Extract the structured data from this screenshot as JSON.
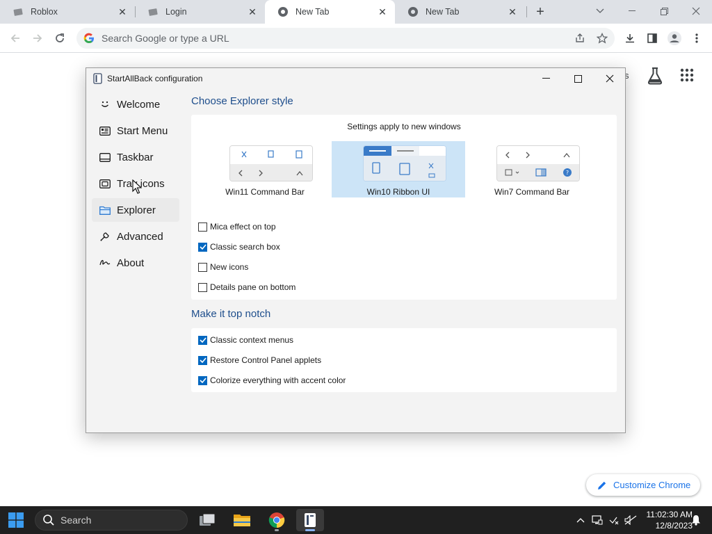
{
  "browser": {
    "tabs": [
      {
        "title": "Roblox",
        "active": false
      },
      {
        "title": "Login",
        "active": false
      },
      {
        "title": "New Tab",
        "active": true
      },
      {
        "title": "New Tab",
        "active": false
      }
    ],
    "omnibox_placeholder": "Search Google or type a URL",
    "ntp_partial_text": "s",
    "customize_label": "Customize Chrome"
  },
  "dialog": {
    "title": "StartAllBack configuration",
    "sidebar": [
      {
        "label": "Welcome",
        "icon": "smile-icon"
      },
      {
        "label": "Start Menu",
        "icon": "start-menu-icon"
      },
      {
        "label": "Taskbar",
        "icon": "taskbar-icon"
      },
      {
        "label": "Tray icons",
        "icon": "tray-icon"
      },
      {
        "label": "Explorer",
        "icon": "folder-icon",
        "selected": true
      },
      {
        "label": "Advanced",
        "icon": "wrench-icon"
      },
      {
        "label": "About",
        "icon": "signature-icon"
      }
    ],
    "explorer_section": {
      "title": "Choose Explorer style",
      "note": "Settings apply to new windows",
      "styles": [
        {
          "label": "Win11 Command Bar",
          "selected": false
        },
        {
          "label": "Win10 Ribbon UI",
          "selected": true
        },
        {
          "label": "Win7 Command Bar",
          "selected": false
        }
      ],
      "options": [
        {
          "label": "Mica effect on top",
          "checked": false
        },
        {
          "label": "Classic search box",
          "checked": true
        },
        {
          "label": "New icons",
          "checked": false
        },
        {
          "label": "Details pane on bottom",
          "checked": false
        }
      ]
    },
    "top_notch_section": {
      "title": "Make it top notch",
      "options": [
        {
          "label": "Classic context menus",
          "checked": true
        },
        {
          "label": "Restore Control Panel applets",
          "checked": true
        },
        {
          "label": "Colorize everything with accent color",
          "checked": true
        }
      ]
    }
  },
  "taskbar": {
    "search_label": "Search",
    "time": "11:02:30 AM",
    "date": "12/8/2023",
    "accent": "#0067c0"
  }
}
